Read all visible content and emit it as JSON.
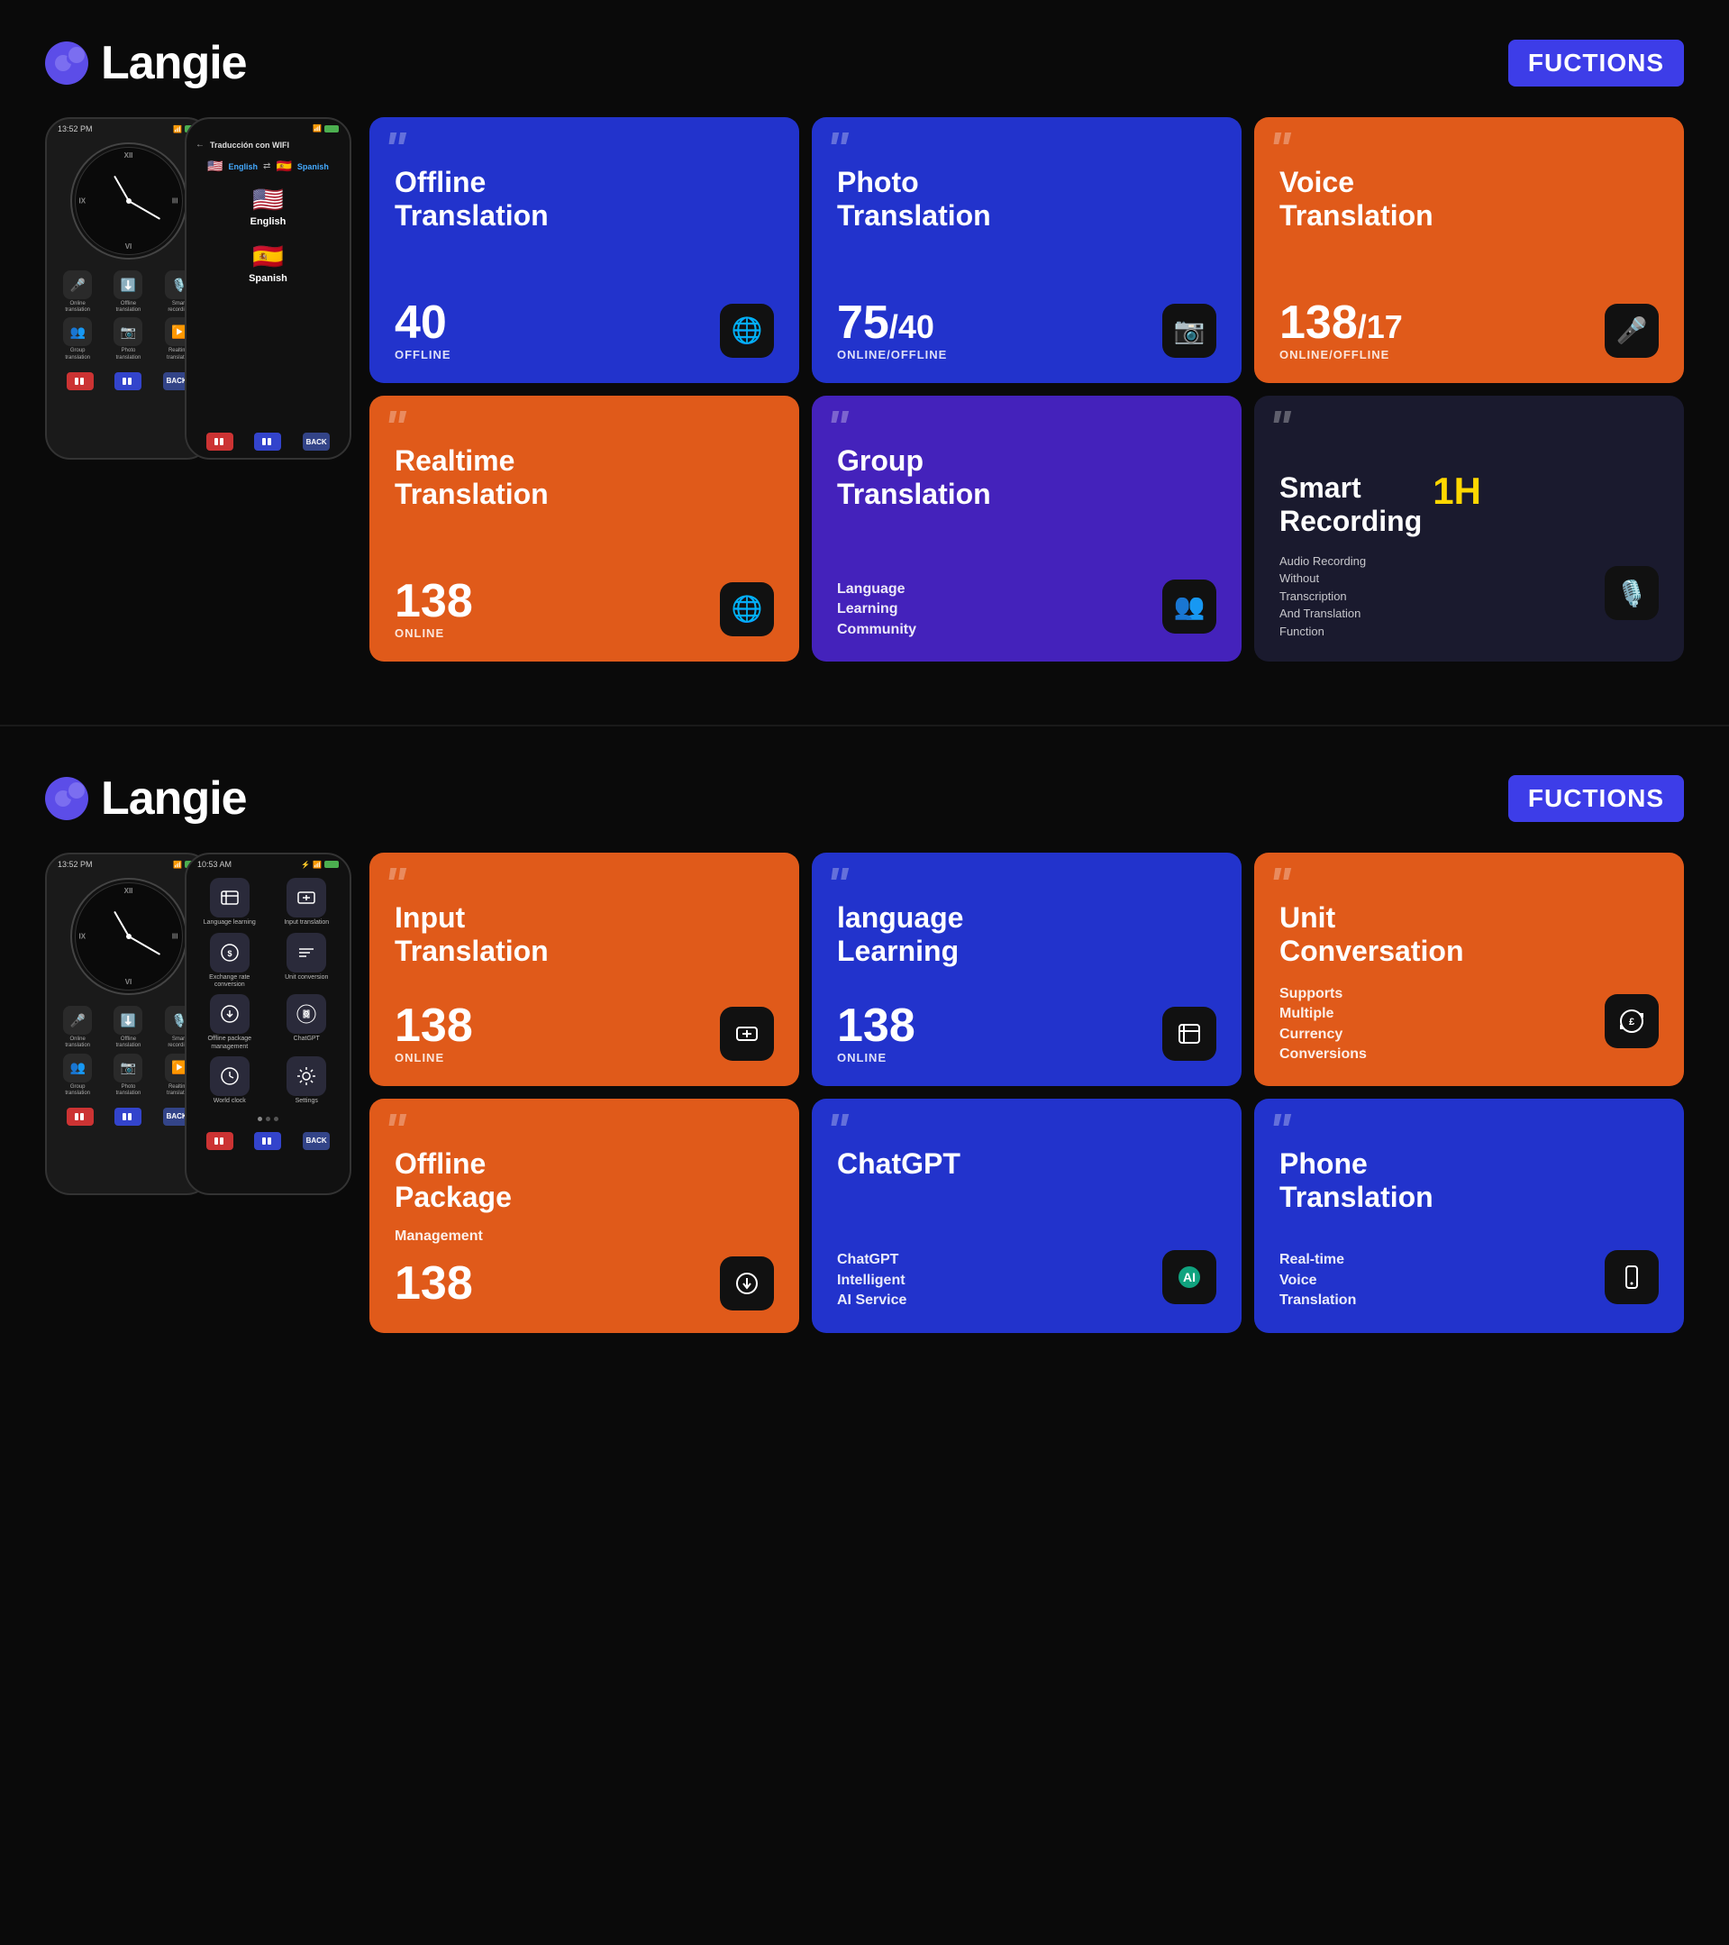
{
  "section1": {
    "logo": "Langie",
    "functions_badge": "FUCTIONS",
    "phone1": {
      "time": "13:52 PM",
      "icons": [
        {
          "icon": "🎤",
          "label": "Online\ntranslation"
        },
        {
          "icon": "⬇️",
          "label": "Offline\ntranslation"
        },
        {
          "icon": "🎙️",
          "label": "Smart\nrecording"
        },
        {
          "icon": "👥",
          "label": "Group\ntranslation"
        },
        {
          "icon": "📷",
          "label": "Photo\ntranslation"
        },
        {
          "icon": "▶️",
          "label": "Realtime\ntranslation"
        }
      ]
    },
    "phone2": {
      "back_label": "Traducción con WIFI",
      "lang_from": "English",
      "lang_from_flag": "🇺🇸",
      "lang_to": "Spanish",
      "lang_to_flag": "🇪🇸"
    },
    "cards": [
      {
        "id": "offline-translation",
        "title": "Offline\nTranslation",
        "count": "40",
        "count_slash": null,
        "status": "OFFLINE",
        "color": "blue",
        "icon": "🌐"
      },
      {
        "id": "photo-translation",
        "title": "Photo\nTranslation",
        "count": "75",
        "count_slash": "40",
        "status": "ONLINE/OFFLINE",
        "color": "blue",
        "icon": "📷"
      },
      {
        "id": "voice-translation",
        "title": "Voice\nTranslation",
        "count": "138",
        "count_slash": "17",
        "status": "ONLINE/OFFLINE",
        "color": "orange",
        "icon": "🎤"
      },
      {
        "id": "realtime-translation",
        "title": "Realtime\nTranslation",
        "count": "138",
        "count_slash": null,
        "status": "ONLINE",
        "color": "orange",
        "icon": "🌐"
      },
      {
        "id": "group-translation",
        "title": "Group\nTranslation",
        "subtitle": "Language\nLearning\nCommunity",
        "count": null,
        "color": "purple",
        "icon": "👥"
      },
      {
        "id": "smart-recording",
        "title": "Smart\nRecording",
        "accent": "1H",
        "description": "Audio Recording Without Transcription And Translation Function",
        "color": "dark",
        "icon": "🎙️"
      }
    ]
  },
  "section2": {
    "logo": "Langie",
    "functions_badge": "FUCTIONS",
    "phone1": {
      "time": "13:52 PM"
    },
    "phone2": {
      "time": "10:53 AM",
      "menu_items": [
        {
          "icon": "📝",
          "label": "Language learning"
        },
        {
          "icon": "💬",
          "label": "Input translation"
        },
        {
          "icon": "💱",
          "label": "Exchange rate conversion"
        },
        {
          "icon": "📏",
          "label": "Unit conversion"
        },
        {
          "icon": "📦",
          "label": "Offline package management"
        },
        {
          "icon": "🤖",
          "label": "ChatGPT"
        },
        {
          "icon": "🕐",
          "label": "World clock"
        },
        {
          "icon": "⚙️",
          "label": "Settings"
        }
      ]
    },
    "cards": [
      {
        "id": "input-translation",
        "title": "Input\nTranslation",
        "count": "138",
        "count_slash": null,
        "status": "ONLINE",
        "color": "orange",
        "icon": "🔤"
      },
      {
        "id": "language-learning",
        "title": "language\nLearning",
        "count": "138",
        "count_slash": null,
        "status": "ONLINE",
        "color": "blue",
        "icon": "🎓"
      },
      {
        "id": "unit-conversation",
        "title": "Unit\nConversation",
        "subtitle": "Supports\nMultiple\nCurrency\nConversions",
        "count": null,
        "color": "orange",
        "icon": "💱"
      },
      {
        "id": "offline-package",
        "title": "Offline\nPackage",
        "subtitle": "Management",
        "count": "138",
        "count_slash": null,
        "status": null,
        "color": "orange",
        "icon": "⬇️"
      },
      {
        "id": "chatgpt",
        "title": "ChatGPT",
        "subtitle": "ChatGPT\nIntelligent\nAI Service",
        "count": null,
        "color": "blue",
        "icon": "🤖"
      },
      {
        "id": "phone-translation",
        "title": "Phone\nTranslation",
        "subtitle": "Real-time\nVoice\nTranslation",
        "count": null,
        "color": "blue",
        "icon": "📱"
      }
    ]
  }
}
